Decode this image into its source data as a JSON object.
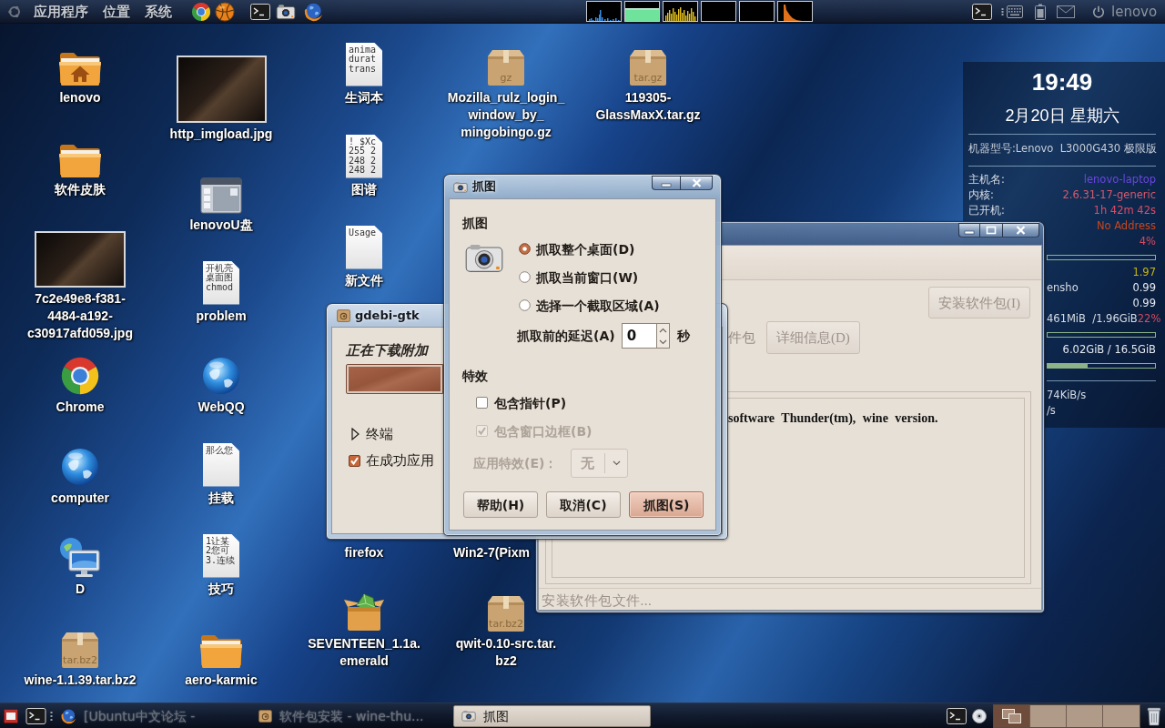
{
  "top_panel": {
    "menus": [
      "应用程序",
      "位置",
      "系统"
    ],
    "user": "lenovo"
  },
  "desktop_icons": [
    {
      "label": "lenovo",
      "kind": "home-folder"
    },
    {
      "label": "软件皮肤",
      "kind": "folder"
    },
    {
      "label": "7c2e49e8-f381-\n4484-a192-\nc30917afd059.jpg",
      "kind": "photo"
    },
    {
      "label": "Chrome",
      "kind": "ring-logo"
    },
    {
      "label": "computer",
      "kind": "globe"
    },
    {
      "label": "D",
      "kind": "monitor"
    },
    {
      "label": "wine-1.1.39.tar.bz2",
      "kind": "archive",
      "badge": "tar.bz2"
    },
    {
      "label": "http_imgload.jpg",
      "kind": "photo"
    },
    {
      "label": "lenovoU盘",
      "kind": "drive-window"
    },
    {
      "label": "problem",
      "kind": "text-file",
      "preview": [
        "开机亮",
        "桌面图",
        "chmod"
      ]
    },
    {
      "label": "WebQQ",
      "kind": "globe"
    },
    {
      "label": "挂载",
      "kind": "text-file",
      "preview": [
        "那么您"
      ]
    },
    {
      "label": "技巧",
      "kind": "text-file",
      "preview": [
        "1让某",
        "2您可",
        "3.连续"
      ]
    },
    {
      "label": "aero-karmic",
      "kind": "folder"
    },
    {
      "label": "生词本",
      "kind": "text-file",
      "preview": [
        "anima",
        "durat",
        "trans"
      ]
    },
    {
      "label": "图谱",
      "kind": "text-file",
      "preview": [
        "! $Xc",
        "255 2",
        "248 2",
        "248 2"
      ]
    },
    {
      "label": "新文件",
      "kind": "text-file",
      "preview": [
        "Usage"
      ]
    },
    {
      "label": "firefox",
      "kind": "covered"
    },
    {
      "label": "SEVENTEEN_1.1a.\nemerald",
      "kind": "gem-box"
    },
    {
      "label": "Mozilla_rulz_login_\nwindow_by_\nmingobingo.gz",
      "kind": "archive",
      "badge": "gz"
    },
    {
      "label": "Win2-7(Pixm",
      "kind": "covered"
    },
    {
      "label": "qwit-0.10-src.tar.\nbz2",
      "kind": "archive",
      "badge": "tar.bz2"
    },
    {
      "label": "119305-\nGlassMaxX.tar.gz",
      "kind": "archive",
      "badge": "tar.gz"
    }
  ],
  "conky": {
    "time": "19:49",
    "date": "2月20日 星期六",
    "model": "机器型号:Lenovo  L3000G430 极限版",
    "info": [
      {
        "label": "主机名:",
        "value": "lenovo-laptop",
        "color": "#6a46e0"
      },
      {
        "label": "内核:",
        "value": "2.6.31-17-generic",
        "color": "#d45a6e"
      },
      {
        "label": "已开机:",
        "value": "1h 42m 42s",
        "color": "#e04c66"
      }
    ],
    "stats": [
      {
        "kind": "text",
        "value": "No Address",
        "color": "#c8461c"
      },
      {
        "kind": "text",
        "value": "4%",
        "color": "#d84a60"
      },
      {
        "kind": "bar"
      },
      {
        "kind": "text",
        "value": "1.97",
        "color": "#c8b414"
      },
      {
        "kind": "text",
        "label": "ensho",
        "value": "0.99",
        "color": "#e6eaf0"
      },
      {
        "kind": "text",
        "value": "0.99",
        "color": "#e6eaf0"
      },
      {
        "kind": "text",
        "label": "461MiB  /1.96GiB",
        "value": "22%",
        "color": "#d84a60"
      },
      {
        "kind": "bar"
      },
      {
        "kind": "text",
        "value": "6.02GiB / 16.5GiB",
        "color": "#e6eaf0"
      },
      {
        "kind": "bar",
        "level": 0.37
      },
      {
        "kind": "rule"
      },
      {
        "kind": "text",
        "label": "74KiB/s"
      },
      {
        "kind": "text",
        "label": "/s"
      }
    ]
  },
  "installer_window": {
    "install_button": {
      "label": "安装软件包(I)",
      "disabled": true
    },
    "partial_label": "件包",
    "details_button": {
      "label": "详细信息(D)",
      "disabled": true
    },
    "description": "software Thunder(tm), wine version.",
    "status": "安装软件包文件..."
  },
  "gdebi_progress": {
    "title": "gdebi-gtk",
    "status": "正在下载附加",
    "level": 1,
    "expander": {
      "label": "终端",
      "expanded": false
    },
    "option": {
      "label": "在成功应用",
      "checked": true
    }
  },
  "screenshot_dialog": {
    "title": "抓图",
    "heading": "抓图",
    "options": [
      {
        "label": "抓取整个桌面(D)",
        "selected": true
      },
      {
        "label": "抓取当前窗口(W)",
        "selected": false
      },
      {
        "label": "选择一个截取区域(A)",
        "selected": false
      }
    ],
    "delay": {
      "label": "抓取前的延迟(A)",
      "value": "0",
      "unit": "秒"
    },
    "effects_heading": "特效",
    "checks": [
      {
        "label": "包含指针(P)",
        "checked": false,
        "disabled": false
      },
      {
        "label": "包含窗口边框(B)",
        "checked": true,
        "disabled": true
      }
    ],
    "effect": {
      "label": "应用特效(E)：",
      "value": "无",
      "disabled": true
    },
    "buttons": [
      {
        "label": "帮助(H)",
        "default": false
      },
      {
        "label": "取消(C)",
        "default": false
      },
      {
        "label": "抓图(S)",
        "default": true
      }
    ]
  },
  "taskbar": {
    "tasks": [
      {
        "title": "[Ubuntu中文论坛 -",
        "selected": false
      },
      {
        "title": "软件包安装 - wine-thu...",
        "selected": false
      },
      {
        "title": "抓图",
        "selected": true
      }
    ],
    "workspaces": [
      {
        "selected": true
      },
      {
        "selected": false
      },
      {
        "selected": false
      },
      {
        "selected": false
      }
    ]
  }
}
